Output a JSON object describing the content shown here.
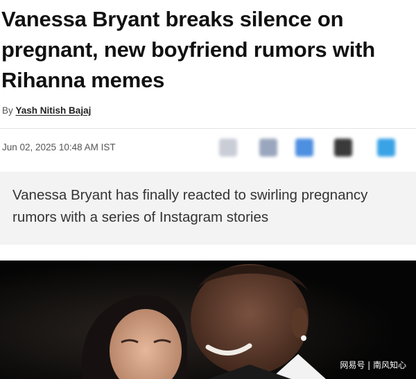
{
  "article": {
    "headline": "Vanessa Bryant breaks silence on pregnant, new boyfriend rumors with Rihanna memes",
    "byline_prefix": "By",
    "author": "Yash Nitish Bajaj",
    "dateline": "Jun 02, 2025 10:48 AM IST",
    "summary": "Vanessa Bryant has finally reacted to swirling pregnancy rumors with a series of Instagram stories"
  },
  "share_icons": [
    {
      "name": "blurred-share-icon-1",
      "color": "#c9cdd6"
    },
    {
      "name": "blurred-share-icon-2",
      "color": "#9aa6bd"
    },
    {
      "name": "blurred-share-icon-3",
      "color": "#4d8fe0"
    },
    {
      "name": "blurred-share-icon-4",
      "color": "#3a3a3a"
    },
    {
      "name": "blurred-share-icon-5",
      "color": "#3aa3e6"
    }
  ],
  "watermark": "网易号 | 南风知心",
  "colors": {
    "headline": "#111111",
    "summary_bg": "#f3f3f3",
    "hero_bg": "#0a0a0a"
  }
}
